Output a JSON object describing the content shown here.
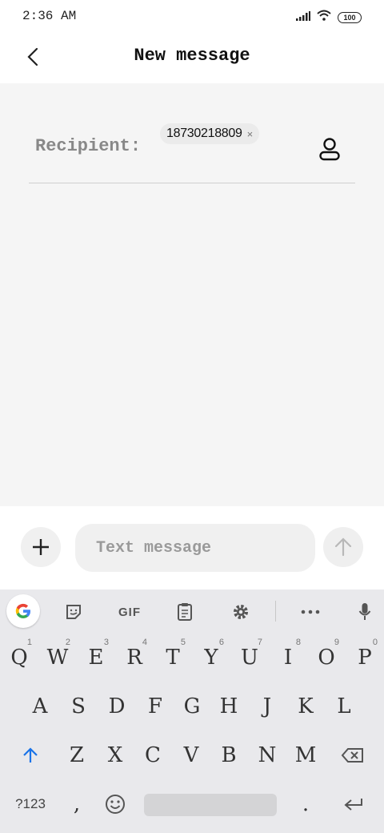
{
  "status_bar": {
    "time": "2:36 AM",
    "battery": "100",
    "icons": [
      "signal-icon",
      "wifi-icon",
      "battery-icon"
    ]
  },
  "header": {
    "title": "New message",
    "back_icon": "back-arrow-icon"
  },
  "recipient": {
    "label": "Recipient:",
    "chip": "18730218809",
    "chip_remove": "×"
  },
  "composer": {
    "placeholder": "Text message",
    "value": ""
  },
  "keyboard": {
    "toolbar": [
      "google-icon",
      "sticker-icon",
      "GIF",
      "clipboard-icon",
      "settings-icon",
      "more-icon",
      "mic-icon"
    ],
    "gif_label": "GIF",
    "row1": [
      {
        "k": "Q",
        "h": "1"
      },
      {
        "k": "W",
        "h": "2"
      },
      {
        "k": "E",
        "h": "3"
      },
      {
        "k": "R",
        "h": "4"
      },
      {
        "k": "T",
        "h": "5"
      },
      {
        "k": "Y",
        "h": "6"
      },
      {
        "k": "U",
        "h": "7"
      },
      {
        "k": "I",
        "h": "8"
      },
      {
        "k": "O",
        "h": "9"
      },
      {
        "k": "P",
        "h": "0"
      }
    ],
    "row2": [
      "A",
      "S",
      "D",
      "F",
      "G",
      "H",
      "J",
      "K",
      "L"
    ],
    "row3": [
      "Z",
      "X",
      "C",
      "V",
      "B",
      "N",
      "M"
    ],
    "row4": {
      "symbols": "?123",
      "comma": ",",
      "period": "."
    },
    "accent_color": "#1a73e8"
  }
}
